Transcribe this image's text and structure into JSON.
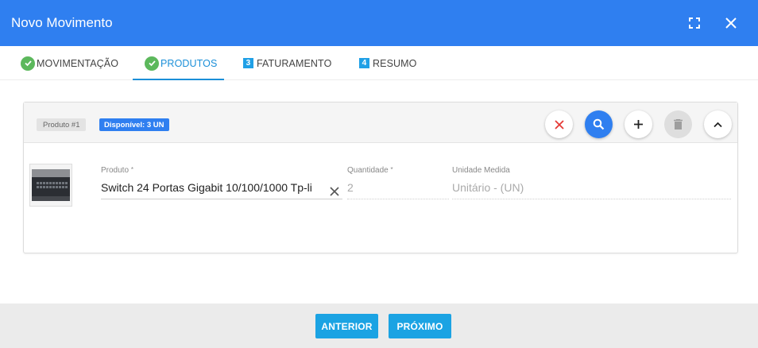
{
  "header": {
    "title": "Novo Movimento"
  },
  "tabs": [
    {
      "label": "MOVIMENTAÇÃO",
      "state": "done"
    },
    {
      "label": "PRODUTOS",
      "state": "active"
    },
    {
      "label": "FATURAMENTO",
      "number": "3"
    },
    {
      "label": "RESUMO",
      "number": "4"
    }
  ],
  "product_card": {
    "chip_label": "Produto #1",
    "availability": "Disponível: 3 UN",
    "fields": {
      "produto": {
        "label": "Produto",
        "required_mark": "*",
        "value": "Switch 24 Portas Gigabit 10/100/1000 Tp-li"
      },
      "quantidade": {
        "label": "Quantidade",
        "required_mark": "*",
        "value": "2"
      },
      "unidade": {
        "label": "Unidade Medida",
        "value": "Unitário - (UN)"
      }
    }
  },
  "footer": {
    "prev_label": "ANTERIOR",
    "next_label": "PRÓXIMO"
  },
  "colors": {
    "primary": "#2f7ff0",
    "action": "#1ba3e3",
    "success": "#5cb85c",
    "danger": "#e53935"
  },
  "icons": [
    "fullscreen-icon",
    "close-icon",
    "check-icon",
    "clear-icon",
    "search-icon",
    "add-icon",
    "trash-icon",
    "chevron-up-icon"
  ]
}
